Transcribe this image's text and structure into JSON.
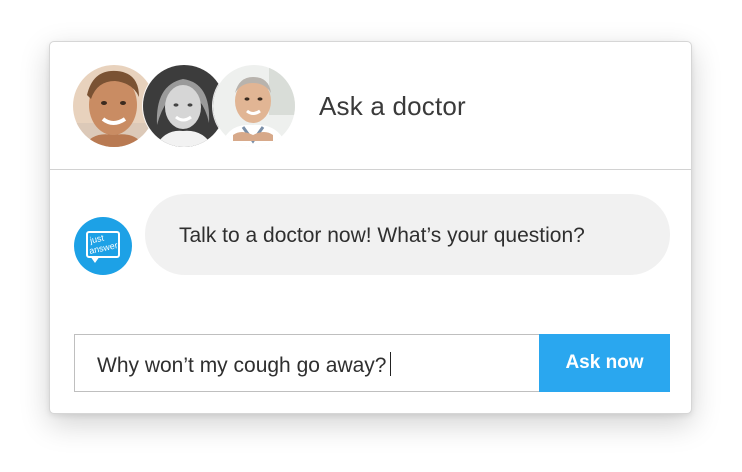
{
  "header": {
    "title": "Ask a doctor",
    "avatars": [
      {
        "name": "doctor-avatar-1"
      },
      {
        "name": "doctor-avatar-2"
      },
      {
        "name": "doctor-avatar-3"
      }
    ]
  },
  "chat": {
    "logo": {
      "line1": "just",
      "line2": "answer"
    },
    "message": "Talk to a doctor now! What’s your question?"
  },
  "question": {
    "value": "Why won’t my cough go away?"
  },
  "ask_button": {
    "label": "Ask now"
  },
  "colors": {
    "accent": "#2aa7ef",
    "logo_blue": "#1da1e6",
    "bubble_bg": "#f1f1f1"
  }
}
